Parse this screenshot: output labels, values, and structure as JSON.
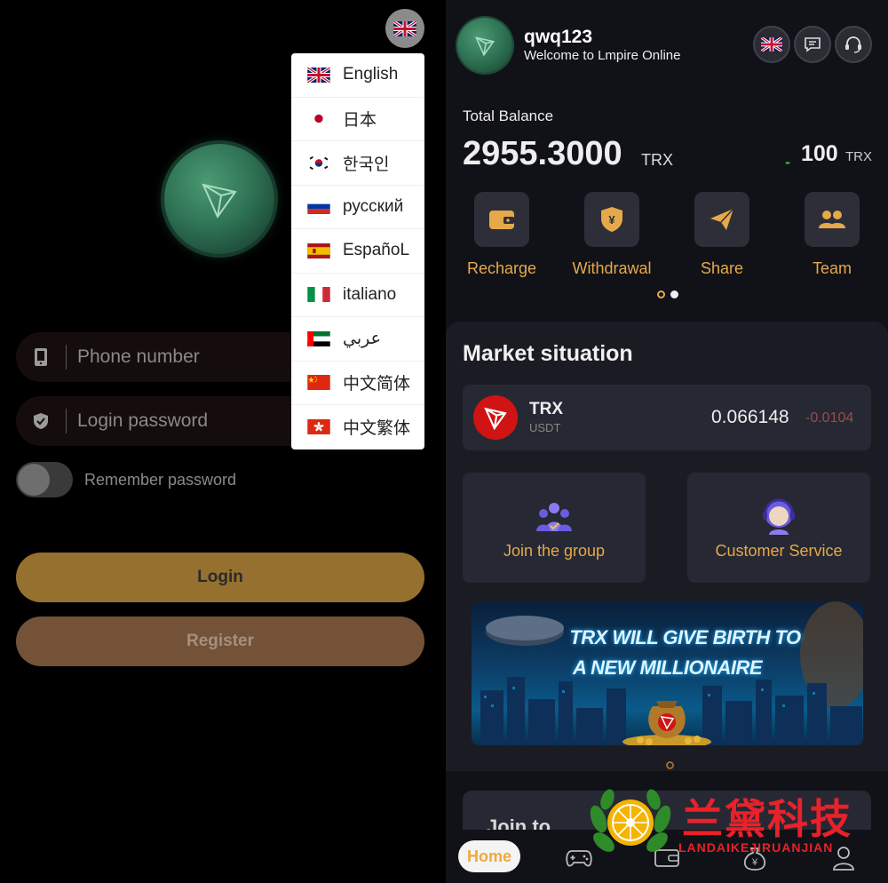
{
  "login": {
    "language_flag": "uk-flag-icon",
    "phone_placeholder": "Phone number",
    "password_placeholder": "Login password",
    "remember_label": "Remember password",
    "login_label": "Login",
    "register_label": "Register",
    "languages": [
      {
        "label": "English",
        "flag": "uk-flag-icon"
      },
      {
        "label": "日本",
        "flag": "japan-flag-icon"
      },
      {
        "label": "한국인",
        "flag": "korea-flag-icon"
      },
      {
        "label": "русский",
        "flag": "russia-flag-icon"
      },
      {
        "label": "EspañoL",
        "flag": "spain-flag-icon"
      },
      {
        "label": "italiano",
        "flag": "italy-flag-icon"
      },
      {
        "label": "عربي",
        "flag": "uae-flag-icon"
      },
      {
        "label": "中文简体",
        "flag": "china-flag-icon"
      },
      {
        "label": "中文繁体",
        "flag": "hongkong-flag-icon"
      }
    ]
  },
  "home": {
    "username": "qwq123",
    "welcome": "Welcome to Lmpire Online",
    "balance": {
      "label": "Total Balance",
      "value": "2955.3000",
      "unit": "TRX",
      "change_sign": "-",
      "change_value": "100",
      "change_unit": "TRX"
    },
    "actions": [
      {
        "label": "Recharge",
        "icon": "wallet-icon"
      },
      {
        "label": "Withdrawal",
        "icon": "yen-shield-icon"
      },
      {
        "label": "Share",
        "icon": "paper-plane-icon"
      },
      {
        "label": "Team",
        "icon": "team-icon"
      }
    ],
    "market": {
      "title": "Market situation",
      "symbol": "TRX",
      "quote": "USDT",
      "price": "0.066148",
      "change": "-0.0104"
    },
    "cards": [
      {
        "label": "Join the group",
        "icon": "group-icon"
      },
      {
        "label": "Customer Service",
        "icon": "customer-service-icon"
      }
    ],
    "banner": {
      "line1": "TRX WILL GIVE BIRTH  TO",
      "line2": "A NEW MILLIONAIRE"
    },
    "section2_title": "Join to",
    "nav": {
      "home_label": "Home"
    }
  },
  "watermark": {
    "cn": "兰黛科技",
    "en": "LANDAIKEJIRUANJIAN"
  },
  "colors": {
    "accent": "#e6a94a",
    "login_button": "#96702e",
    "register_button": "#735237",
    "positive": "#2eb55a",
    "negative": "#d03030"
  }
}
